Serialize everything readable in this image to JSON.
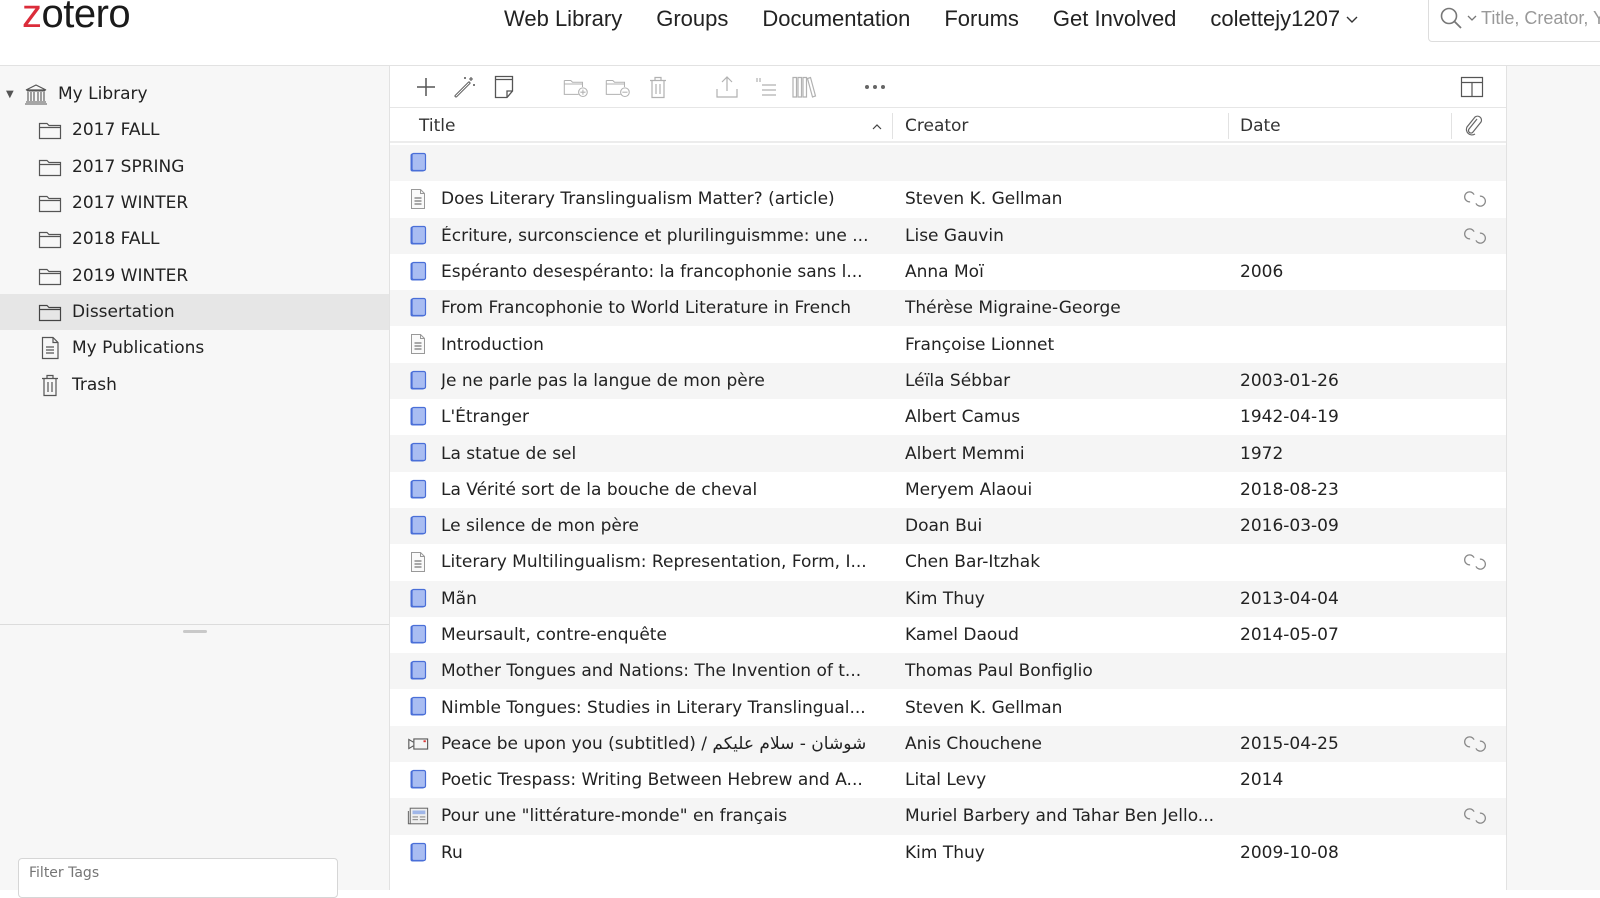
{
  "app": {
    "logo_prefix": "z",
    "logo_rest": "otero"
  },
  "nav": {
    "links": [
      "Web Library",
      "Groups",
      "Documentation",
      "Forums",
      "Get Involved"
    ],
    "user": "colettejy1207",
    "search_placeholder": "Title, Creator, Year"
  },
  "sidebar": {
    "library_label": "My Library",
    "collections": [
      {
        "label": "2017 FALL",
        "icon": "folder-icon"
      },
      {
        "label": "2017 SPRING",
        "icon": "folder-icon"
      },
      {
        "label": "2017 WINTER",
        "icon": "folder-icon"
      },
      {
        "label": "2018 FALL",
        "icon": "folder-icon"
      },
      {
        "label": "2019 WINTER",
        "icon": "folder-icon"
      },
      {
        "label": "Dissertation",
        "icon": "folder-icon",
        "selected": true
      },
      {
        "label": "My Publications",
        "icon": "document-icon"
      },
      {
        "label": "Trash",
        "icon": "trash-icon"
      }
    ],
    "tag_filter_placeholder": "Filter Tags"
  },
  "toolbar": {
    "buttons": [
      "new-item",
      "add-by-identifier",
      "new-note",
      "add-to-collection",
      "remove-from-collection",
      "move-to-trash",
      "export",
      "create-bibliography",
      "generate-report",
      "more"
    ]
  },
  "table": {
    "columns": {
      "title": "Title",
      "creator": "Creator",
      "date": "Date"
    },
    "sort_column": "Title",
    "sort_direction": "ascending",
    "rows": [
      {
        "type": "book",
        "title": "",
        "creator": "",
        "date": "",
        "attachment": false
      },
      {
        "type": "document",
        "title": "Does Literary Translingualism Matter? (article)",
        "creator": "Steven K. Gellman",
        "date": "",
        "attachment": true
      },
      {
        "type": "book",
        "title": "Écriture, surconscience et plurilinguismme: une ...",
        "creator": "Lise Gauvin",
        "date": "",
        "attachment": true
      },
      {
        "type": "book",
        "title": "Espéranto desespéranto: la francophonie sans l...",
        "creator": "Anna Moï",
        "date": "2006",
        "attachment": false
      },
      {
        "type": "book",
        "title": "From Francophonie to World Literature in French",
        "creator": "Thérèse Migraine-George",
        "date": "",
        "attachment": false
      },
      {
        "type": "document",
        "title": "Introduction",
        "creator": "Françoise Lionnet",
        "date": "",
        "attachment": false
      },
      {
        "type": "book",
        "title": "Je ne parle pas la langue de mon père",
        "creator": "Léïla Sébbar",
        "date": "2003-01-26",
        "attachment": false
      },
      {
        "type": "book",
        "title": "L'Étranger",
        "creator": "Albert Camus",
        "date": "1942-04-19",
        "attachment": false
      },
      {
        "type": "book",
        "title": "La statue de sel",
        "creator": "Albert Memmi",
        "date": "1972",
        "attachment": false
      },
      {
        "type": "book",
        "title": "La Vérité sort de la bouche de cheval",
        "creator": "Meryem Alaoui",
        "date": "2018-08-23",
        "attachment": false
      },
      {
        "type": "book",
        "title": "Le silence de mon père",
        "creator": "Doan Bui",
        "date": "2016-03-09",
        "attachment": false
      },
      {
        "type": "document",
        "title": "Literary Multilingualism: Representation, Form, I...",
        "creator": "Chen Bar-Itzhak",
        "date": "",
        "attachment": true
      },
      {
        "type": "book",
        "title": "Mãn",
        "creator": "Kim Thuy",
        "date": "2013-04-04",
        "attachment": false
      },
      {
        "type": "book",
        "title": "Meursault, contre-enquête",
        "creator": "Kamel Daoud",
        "date": "2014-05-07",
        "attachment": false
      },
      {
        "type": "book",
        "title": "Mother Tongues and Nations: The Invention of t...",
        "creator": "Thomas Paul Bonfiglio",
        "date": "",
        "attachment": false
      },
      {
        "type": "book",
        "title": "Nimble Tongues: Studies in Literary Translingual...",
        "creator": "Steven K. Gellman",
        "date": "",
        "attachment": false
      },
      {
        "type": "video",
        "title": "Peace be upon you (subtitled) / انيس شوشان - سلام عليكم",
        "creator": "Anis Chouchene",
        "date": "2015-04-25",
        "attachment": true
      },
      {
        "type": "book",
        "title": "Poetic Trespass: Writing Between Hebrew and A...",
        "creator": "Lital Levy",
        "date": "2014",
        "attachment": false
      },
      {
        "type": "newspaper",
        "title": "Pour une \"littérature-monde\" en français",
        "creator": "Muriel Barbery and Tahar Ben Jello...",
        "date": "",
        "attachment": true
      },
      {
        "type": "book",
        "title": "Ru",
        "creator": "Kim Thuy",
        "date": "2009-10-08",
        "attachment": false
      }
    ]
  },
  "colors": {
    "brand_red": "#db2c3a",
    "book_icon_fill": "#a9bdf2",
    "book_icon_stroke": "#4a6fd8",
    "selected_row": "#e6e6e6",
    "alt_row": "#f5f5f5"
  }
}
